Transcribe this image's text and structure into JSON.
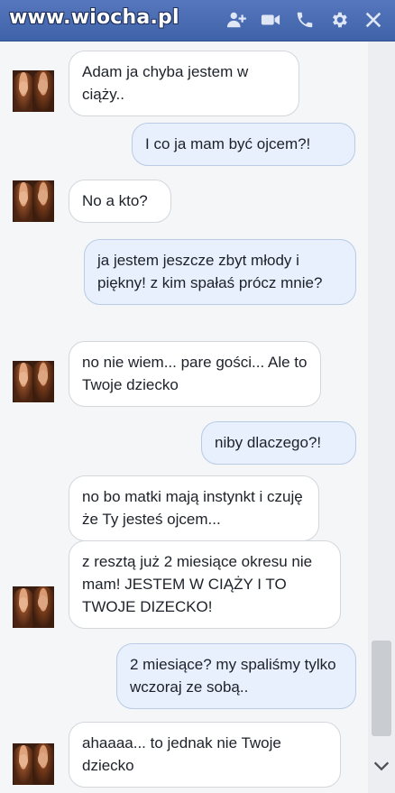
{
  "header": {
    "watermark": "www.wiocha.pl",
    "icons": [
      "add-person-icon",
      "video-call-icon",
      "phone-icon",
      "gear-icon",
      "close-icon"
    ]
  },
  "messages": [
    {
      "from": "her",
      "text": "Adam ja chyba jestem w ciąży.."
    },
    {
      "from": "me",
      "text": "I co ja mam być ojcem?!"
    },
    {
      "from": "her",
      "text": "No a kto?"
    },
    {
      "from": "me",
      "text": "ja jestem jeszcze zbyt młody i piękny! z kim spałaś prócz mnie?"
    },
    {
      "from": "her",
      "text": "no nie wiem... pare gości... Ale to Twoje dziecko"
    },
    {
      "from": "me",
      "text": "niby dlaczego?!"
    },
    {
      "from": "her",
      "text": "no bo matki mają instynkt i czuję że Ty jesteś ojcem..."
    },
    {
      "from": "her",
      "text": "z resztą już 2 miesiące okresu nie mam! JESTEM W CIĄŻY I TO TWOJE DIZECKO!"
    },
    {
      "from": "me",
      "text": "2 miesiące? my spaliśmy tylko wczoraj ze sobą.."
    },
    {
      "from": "her",
      "text": "ahaaaa... to jednak nie Twoje dziecko"
    }
  ],
  "colors": {
    "header": "#4a6fb5",
    "incoming_bubble": "#ffffff",
    "outgoing_bubble": "#e7f0fc",
    "background": "#f5f6f7"
  }
}
